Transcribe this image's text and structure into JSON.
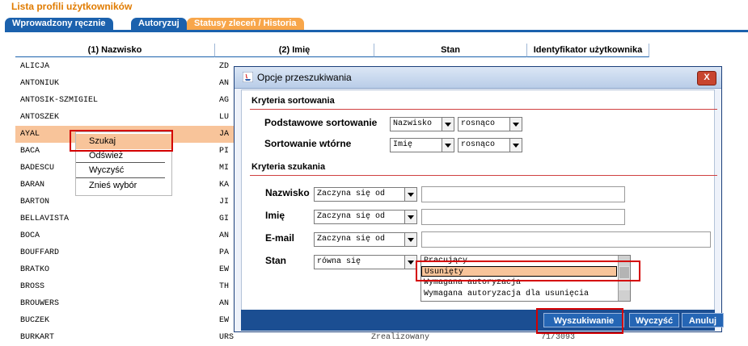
{
  "page": {
    "title": "Lista profili użytkowników",
    "tabs": [
      {
        "label": "Wprowadzony ręcznie"
      },
      {
        "label": "Autoryzuj"
      },
      {
        "label": "Statusy zleceń / Historia"
      }
    ]
  },
  "grid": {
    "columns": [
      "(1) Nazwisko",
      "(2) Imię",
      "Stan",
      "Identyfikator użytkownika"
    ],
    "rows": [
      {
        "last": "ALICJA",
        "first": "ZD"
      },
      {
        "last": "ANTONIUK",
        "first": "AN"
      },
      {
        "last": "ANTOSIK-SZMIGIEL",
        "first": "AG"
      },
      {
        "last": "ANTOSZEK",
        "first": "LU"
      },
      {
        "last": "AYAL",
        "first": "JA"
      },
      {
        "last": "BACA",
        "first": "PI"
      },
      {
        "last": "BADESCU",
        "first": "MI"
      },
      {
        "last": "BARAN",
        "first": "KA"
      },
      {
        "last": "BARTON",
        "first": "JI"
      },
      {
        "last": "BELLAVISTA",
        "first": "GI"
      },
      {
        "last": "BOCA",
        "first": "AN"
      },
      {
        "last": "BOUFFARD",
        "first": "PA"
      },
      {
        "last": "BRATKO",
        "first": "EW"
      },
      {
        "last": "BROSS",
        "first": "TH"
      },
      {
        "last": "BROUWERS",
        "first": "AN"
      },
      {
        "last": "BUCZEK",
        "first": "EW"
      },
      {
        "last": "BURKART",
        "first": "URS",
        "state": "Zrealizowany",
        "id": "71/3093"
      }
    ]
  },
  "context_menu": {
    "items": [
      "Szukaj",
      "Odśwież",
      "Wyczyść",
      "Znieś wybór"
    ]
  },
  "dialog": {
    "title": "Opcje przeszukiwania",
    "close_label": "X",
    "sorting": {
      "section": "Kryteria sortowania",
      "primary_label": "Podstawowe sortowanie",
      "primary_field": "Nazwisko",
      "primary_order": "rosnąco",
      "secondary_label": "Sortowanie wtórne",
      "secondary_field": "Imię",
      "secondary_order": "rosnąco"
    },
    "search": {
      "section": "Kryteria szukania",
      "lastname_label": "Nazwisko",
      "lastname_op": "Zaczyna się od",
      "lastname_value": "",
      "firstname_label": "Imię",
      "firstname_op": "Zaczyna się od",
      "firstname_value": "",
      "email_label": "E-mail",
      "email_op": "Zaczyna się od",
      "email_value": "",
      "state_label": "Stan",
      "state_op": "równa się",
      "state_options": [
        "Pracujący",
        "Usunięty",
        "Wymagana autoryzacja",
        "Wymagana autoryzacja dla usunięcia"
      ],
      "state_selected": "Usunięty"
    },
    "buttons": {
      "search": "Wyszukiwanie",
      "clear": "Wyczyść",
      "cancel": "Anuluj"
    }
  },
  "colors": {
    "tab_blue": "#1b61ad",
    "tab_orange": "#f8a64a",
    "title_orange": "#e07b00",
    "highlight": "#f8c49a",
    "annotation_red": "#d40000"
  }
}
